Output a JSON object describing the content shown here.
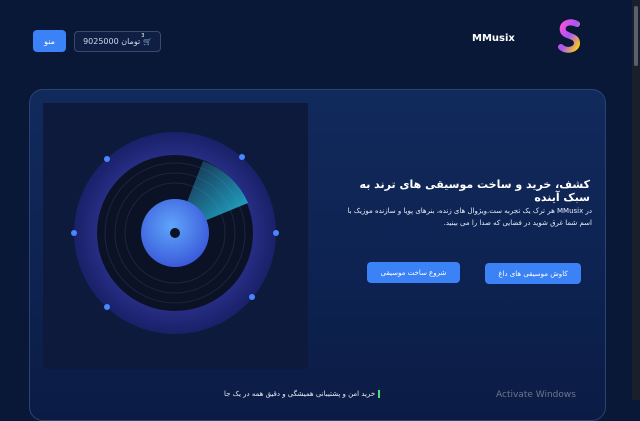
{
  "header": {
    "menu_label": "منو",
    "wallet_amount": "9025000 تومان",
    "cart_count": "3",
    "brand": "MMusix"
  },
  "hero": {
    "title": "کشف، خرید و ساخت موسیقی های ترند به سبک آینده",
    "description": "در MMusix هر ترک یک تجربه ست.ویژوال های زنده، بنرهای پویا و سازنده موزیک با اسم شما غرق شوید در فضایی که صدا را می بینید.",
    "explore_button": "کاوش موسیقی های داغ",
    "create_button": "شروع ساخت موسیقی",
    "feature_text": "خرید امن و پشتیبانی همیشگی و دقیق همه در یک جا"
  },
  "system": {
    "watermark": "Activate Windows"
  },
  "colors": {
    "accent": "#3b82f6",
    "background": "#0a1838",
    "card": "#112a5c"
  }
}
